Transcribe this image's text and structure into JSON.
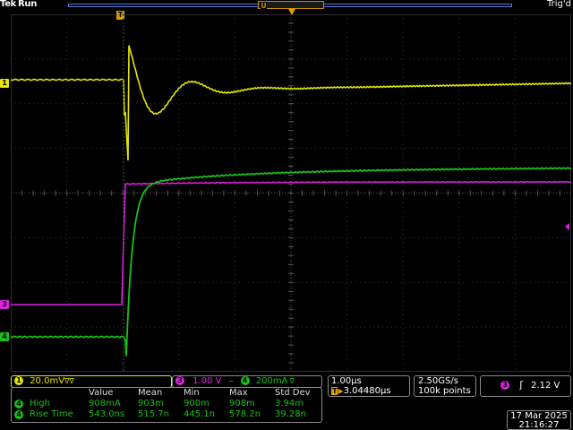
{
  "colors": {
    "ch1": "#e6e600",
    "ch3": "#e020e0",
    "ch4": "#19c019",
    "trigger": "#e0a000",
    "grid": "#5a5a5a",
    "panel_border": "#8a8a8a"
  },
  "topbar": {
    "brand": "Tek",
    "acq_state": "Run",
    "trig_state": "Trig'd",
    "trig_marker": "T",
    "window_marker": "U"
  },
  "markers": {
    "ch1": "1",
    "ch3": "3",
    "ch4": "4",
    "trigger": "T"
  },
  "ch1_panel": {
    "badge": "1",
    "scale": "20.0mV",
    "suffix": "∇∇"
  },
  "ch3_panel": {
    "badge": "3",
    "scale": "1.00 V"
  },
  "ch4_panel": {
    "badge": "4",
    "scale": "200mA",
    "suffix": "∇"
  },
  "horizontal": {
    "scale": "1.00µs",
    "trig_icon": "T",
    "delay": "3.04480µs"
  },
  "sampling": {
    "rate": "2.50GS/s",
    "record": "100k points"
  },
  "trigger_panel": {
    "badge": "3",
    "slope_icon": "rising-edge-icon",
    "slope_symbol": "ʃ",
    "level": "2.12 V"
  },
  "measurements": {
    "headers": [
      "Value",
      "Mean",
      "Min",
      "Max",
      "Std Dev"
    ],
    "rows": [
      {
        "badge": "4",
        "name": "High",
        "values": [
          "908mA",
          "903m",
          "900m",
          "908m",
          "3.94m"
        ]
      },
      {
        "badge": "4",
        "name": "Rise Time",
        "values": [
          "543.0ns",
          "515.7n",
          "445.1n",
          "578.2n",
          "39.28n"
        ]
      }
    ]
  },
  "datetime": {
    "date": "17 Mar 2025",
    "time": "21:16:27"
  }
}
